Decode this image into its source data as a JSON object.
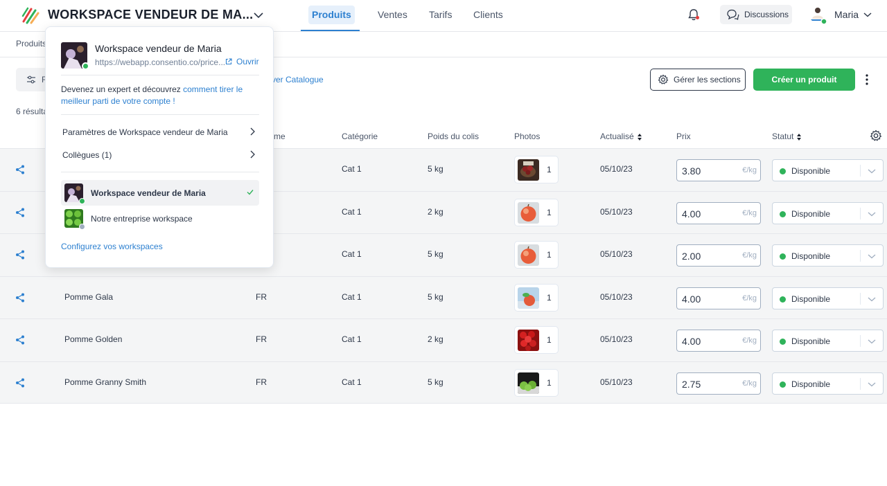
{
  "header": {
    "workspace_title": "WORKSPACE VENDEUR DE MA...",
    "nav": [
      {
        "label": "Produits",
        "active": true
      },
      {
        "label": "Ventes",
        "active": false
      },
      {
        "label": "Tarifs",
        "active": false
      },
      {
        "label": "Clients",
        "active": false
      }
    ],
    "discussions_label": "Discussions",
    "user_name": "Maria",
    "accent_color": "#2d80d0"
  },
  "breadcrumb": "Produits",
  "toolbar": {
    "filter_label": "F",
    "catalog_link": "ver Catalogue",
    "sections_label": "Gérer les sections",
    "create_label": "Créer un produit",
    "create_color": "#2fb35a"
  },
  "results_label": "6 résulta",
  "table": {
    "columns": [
      {
        "label": "me",
        "sortable": false
      },
      {
        "label": "Catégorie",
        "sortable": false
      },
      {
        "label": "Poids du colis",
        "sortable": false
      },
      {
        "label": "Photos",
        "sortable": false
      },
      {
        "label": "Actualisé",
        "sortable": true
      },
      {
        "label": "Prix",
        "sortable": false
      },
      {
        "label": "Statut",
        "sortable": true
      }
    ],
    "rows": [
      {
        "name": "",
        "origin": "",
        "category": "Cat 1",
        "weight": "5 kg",
        "photos": "1",
        "thumb": "cherries",
        "updated": "05/10/23",
        "price": "3.80",
        "unit": "€/kg",
        "status": "Disponible"
      },
      {
        "name": "",
        "origin": "",
        "category": "Cat 1",
        "weight": "2 kg",
        "photos": "1",
        "thumb": "apple-red",
        "updated": "05/10/23",
        "price": "4.00",
        "unit": "€/kg",
        "status": "Disponible"
      },
      {
        "name": "",
        "origin": "",
        "category": "Cat 1",
        "weight": "5 kg",
        "photos": "1",
        "thumb": "apple-red",
        "updated": "05/10/23",
        "price": "2.00",
        "unit": "€/kg",
        "status": "Disponible"
      },
      {
        "name": "Pomme Gala",
        "origin": "FR",
        "category": "Cat 1",
        "weight": "5 kg",
        "photos": "1",
        "thumb": "apple-leaf",
        "updated": "05/10/23",
        "price": "4.00",
        "unit": "€/kg",
        "status": "Disponible"
      },
      {
        "name": "Pomme Golden",
        "origin": "FR",
        "category": "Cat 1",
        "weight": "2 kg",
        "photos": "1",
        "thumb": "apples-many",
        "updated": "05/10/23",
        "price": "4.00",
        "unit": "€/kg",
        "status": "Disponible"
      },
      {
        "name": "Pomme Granny Smith",
        "origin": "FR",
        "category": "Cat 1",
        "weight": "5 kg",
        "photos": "1",
        "thumb": "apples-green",
        "updated": "05/10/23",
        "price": "2.75",
        "unit": "€/kg",
        "status": "Disponible"
      }
    ]
  },
  "dropdown": {
    "workspace_name": "Workspace vendeur de Maria",
    "url": "https://webapp.consentio.co/price...",
    "open_label": "Ouvrir",
    "tip_prefix": "Devenez un expert et découvrez ",
    "tip_link": "comment tirer le meilleur parti de votre compte !",
    "settings_label": "Paramètres de Workspace vendeur de Maria",
    "colleagues_label": "Collègues (1)",
    "workspaces": [
      {
        "label": "Workspace vendeur de Maria",
        "selected": true,
        "dot_color": "#2fb35a"
      },
      {
        "label": "Notre entreprise workspace",
        "selected": false,
        "dot_color": "#a0aec0"
      }
    ],
    "configure_label": "Configurez vos workspaces"
  }
}
